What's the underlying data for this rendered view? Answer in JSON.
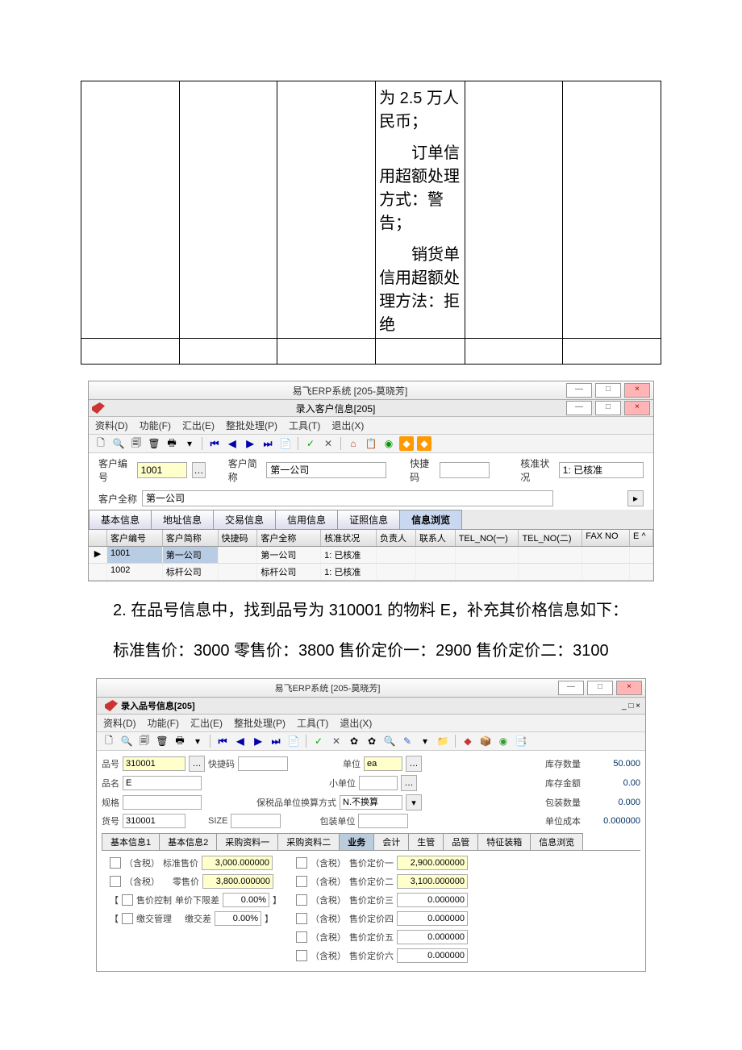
{
  "doc": {
    "cell_text_1": "为 2.5 万人民币；",
    "cell_text_2": "订单信用超额处理方式：警告；",
    "cell_text_3": "销货单信用超额处理方法：拒绝",
    "para_2": "2. 在品号信息中，找到品号为 310001 的物料 E，补充其价格信息如下：",
    "para_3": "标准售价：3000 零售价：3800 售价定价一：2900 售价定价二：3100"
  },
  "win1": {
    "title": "易飞ERP系统 [205-莫晓芳]",
    "subtitle": "录入客户信息[205]",
    "menus": [
      "资料(D)",
      "功能(F)",
      "汇出(E)",
      "整批处理(P)",
      "工具(T)",
      "退出(X)"
    ],
    "fields": {
      "cust_no_label": "客户编号",
      "cust_no": "1001",
      "cust_short_label": "客户简称",
      "cust_short": "第一公司",
      "quick_code_label": "快捷码",
      "quick_code": "",
      "status_label": "核准状况",
      "status": "1: 已核准",
      "cust_full_label": "客户全称",
      "cust_full": "第一公司"
    },
    "tabs": [
      "基本信息",
      "地址信息",
      "交易信息",
      "信用信息",
      "证照信息",
      "信息浏览"
    ],
    "grid": {
      "headers": [
        "",
        "客户编号",
        "客户简称",
        "快捷码",
        "客户全称",
        "核准状况",
        "负责人",
        "联系人",
        "TEL_NO(一)",
        "TEL_NO(二)",
        "FAX NO",
        "E ^"
      ],
      "rows": [
        [
          "▶",
          "1001",
          "第一公司",
          "",
          "第一公司",
          "1: 已核准",
          "",
          "",
          "",
          "",
          "",
          ""
        ],
        [
          "",
          "1002",
          "标杆公司",
          "",
          "标杆公司",
          "1: 已核准",
          "",
          "",
          "",
          "",
          "",
          ""
        ]
      ]
    }
  },
  "win2": {
    "title": "易飞ERP系统 [205-莫晓芳]",
    "subtitle": "录入品号信息[205]",
    "menus": [
      "资料(D)",
      "功能(F)",
      "汇出(E)",
      "整批处理(P)",
      "工具(T)",
      "退出(X)"
    ],
    "header": {
      "pn_label": "品号",
      "pn": "310001",
      "quick_label": "快捷码",
      "quick": "",
      "unit_label": "单位",
      "unit": "ea",
      "small_unit_label": "小单位",
      "small_unit": "",
      "stock_qty_label": "库存数量",
      "stock_qty": "50.000",
      "name_label": "品名",
      "name": "E",
      "stock_amt_label": "库存金额",
      "stock_amt": "0.00",
      "spec_label": "规格",
      "spec": "",
      "pack_calc_label": "保税品单位换算方式",
      "pack_calc": "N.不换算",
      "pack_qty_label": "包装数量",
      "pack_qty": "0.000",
      "lot_label": "货号",
      "lot": "310001",
      "size_label": "SIZE",
      "size": "",
      "pack_unit_label": "包装单位",
      "pack_unit": "",
      "unit_cost_label": "单位成本",
      "unit_cost": "0.000000"
    },
    "tabs2": [
      "基本信息1",
      "基本信息2",
      "采购资料一",
      "采购资料二",
      "业务",
      "会计",
      "生管",
      "品管",
      "特征装箱",
      "信息浏览"
    ],
    "prices": {
      "tax_prefix": "（含税）",
      "std_price_label": "标准售价",
      "std_price": "3,000.000000",
      "retail_label": "零售价",
      "retail": "3,800.000000",
      "price_ctrl_label": "售价控制",
      "price_ctrl_mode": "单价下限差",
      "price_ctrl_val": "0.00%",
      "submit_mgmt_label": "缴交管理",
      "submit_mode": "缴交差",
      "submit_val": "0.00%",
      "fp1_label": "售价定价一",
      "fp1": "2,900.000000",
      "fp2_label": "售价定价二",
      "fp2": "3,100.000000",
      "fp3_label": "售价定价三",
      "fp3": "0.000000",
      "fp4_label": "售价定价四",
      "fp4": "0.000000",
      "fp5_label": "售价定价五",
      "fp5": "0.000000",
      "fp6_label": "售价定价六",
      "fp6": "0.000000"
    }
  }
}
